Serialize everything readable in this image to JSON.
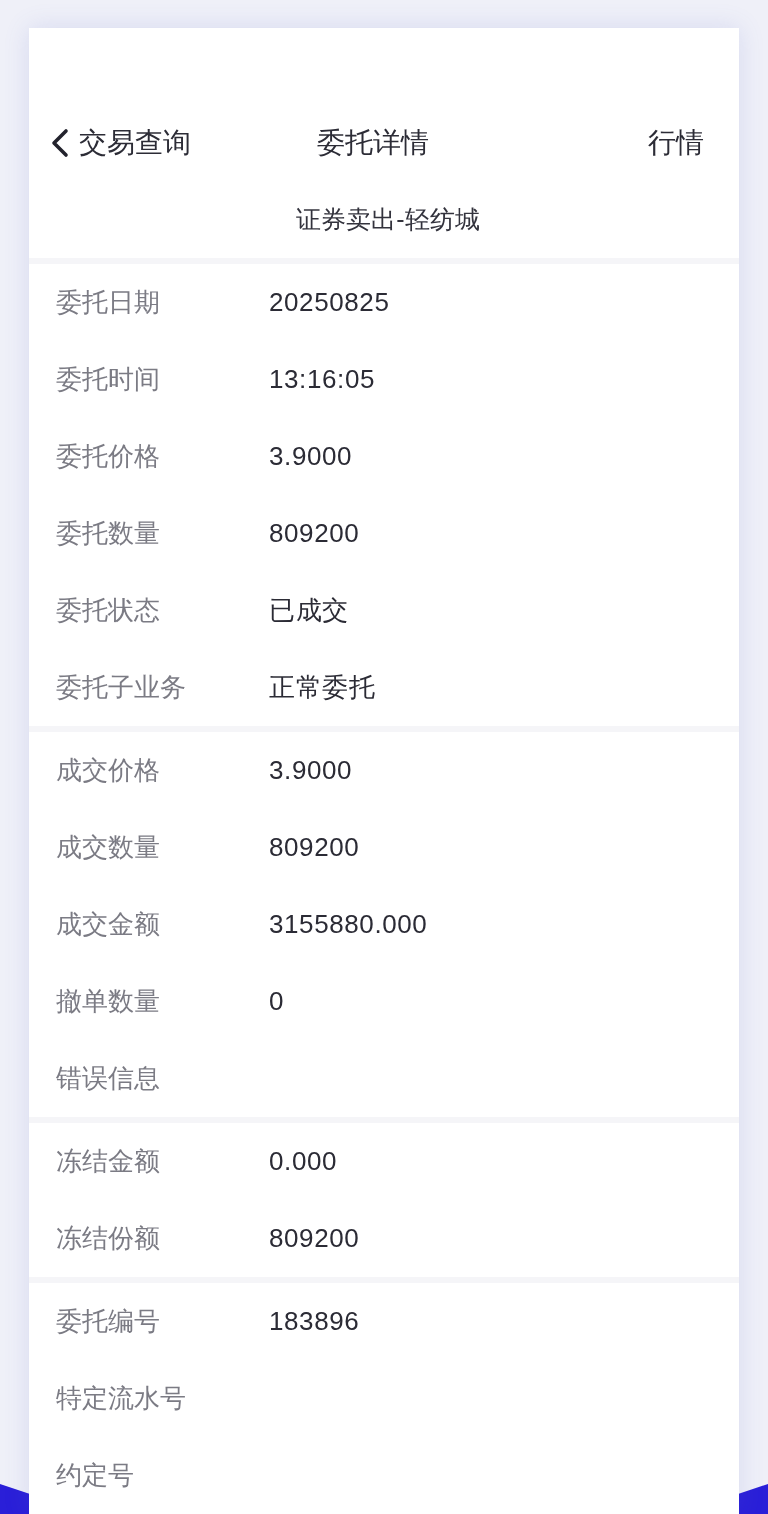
{
  "nav": {
    "back_label": "交易查询",
    "title": "委托详情",
    "action": "行情"
  },
  "subtitle": "证券卖出-轻纺城",
  "sections": [
    {
      "rows": [
        {
          "label": "委托日期",
          "value": "20250825"
        },
        {
          "label": "委托时间",
          "value": "13:16:05"
        },
        {
          "label": "委托价格",
          "value": "3.9000"
        },
        {
          "label": "委托数量",
          "value": "809200"
        },
        {
          "label": "委托状态",
          "value": "已成交"
        },
        {
          "label": "委托子业务",
          "value": "正常委托"
        }
      ]
    },
    {
      "rows": [
        {
          "label": "成交价格",
          "value": "3.9000"
        },
        {
          "label": "成交数量",
          "value": "809200"
        },
        {
          "label": "成交金额",
          "value": "3155880.000"
        },
        {
          "label": "撤单数量",
          "value": "0"
        },
        {
          "label": "错误信息"
        }
      ]
    },
    {
      "rows": [
        {
          "label": "冻结金额",
          "value": "0.000"
        },
        {
          "label": "冻结份额",
          "value": "809200"
        }
      ]
    },
    {
      "rows": [
        {
          "label": "委托编号",
          "value": "183896"
        },
        {
          "label": "特定流水号"
        },
        {
          "label": "约定号"
        }
      ]
    }
  ]
}
